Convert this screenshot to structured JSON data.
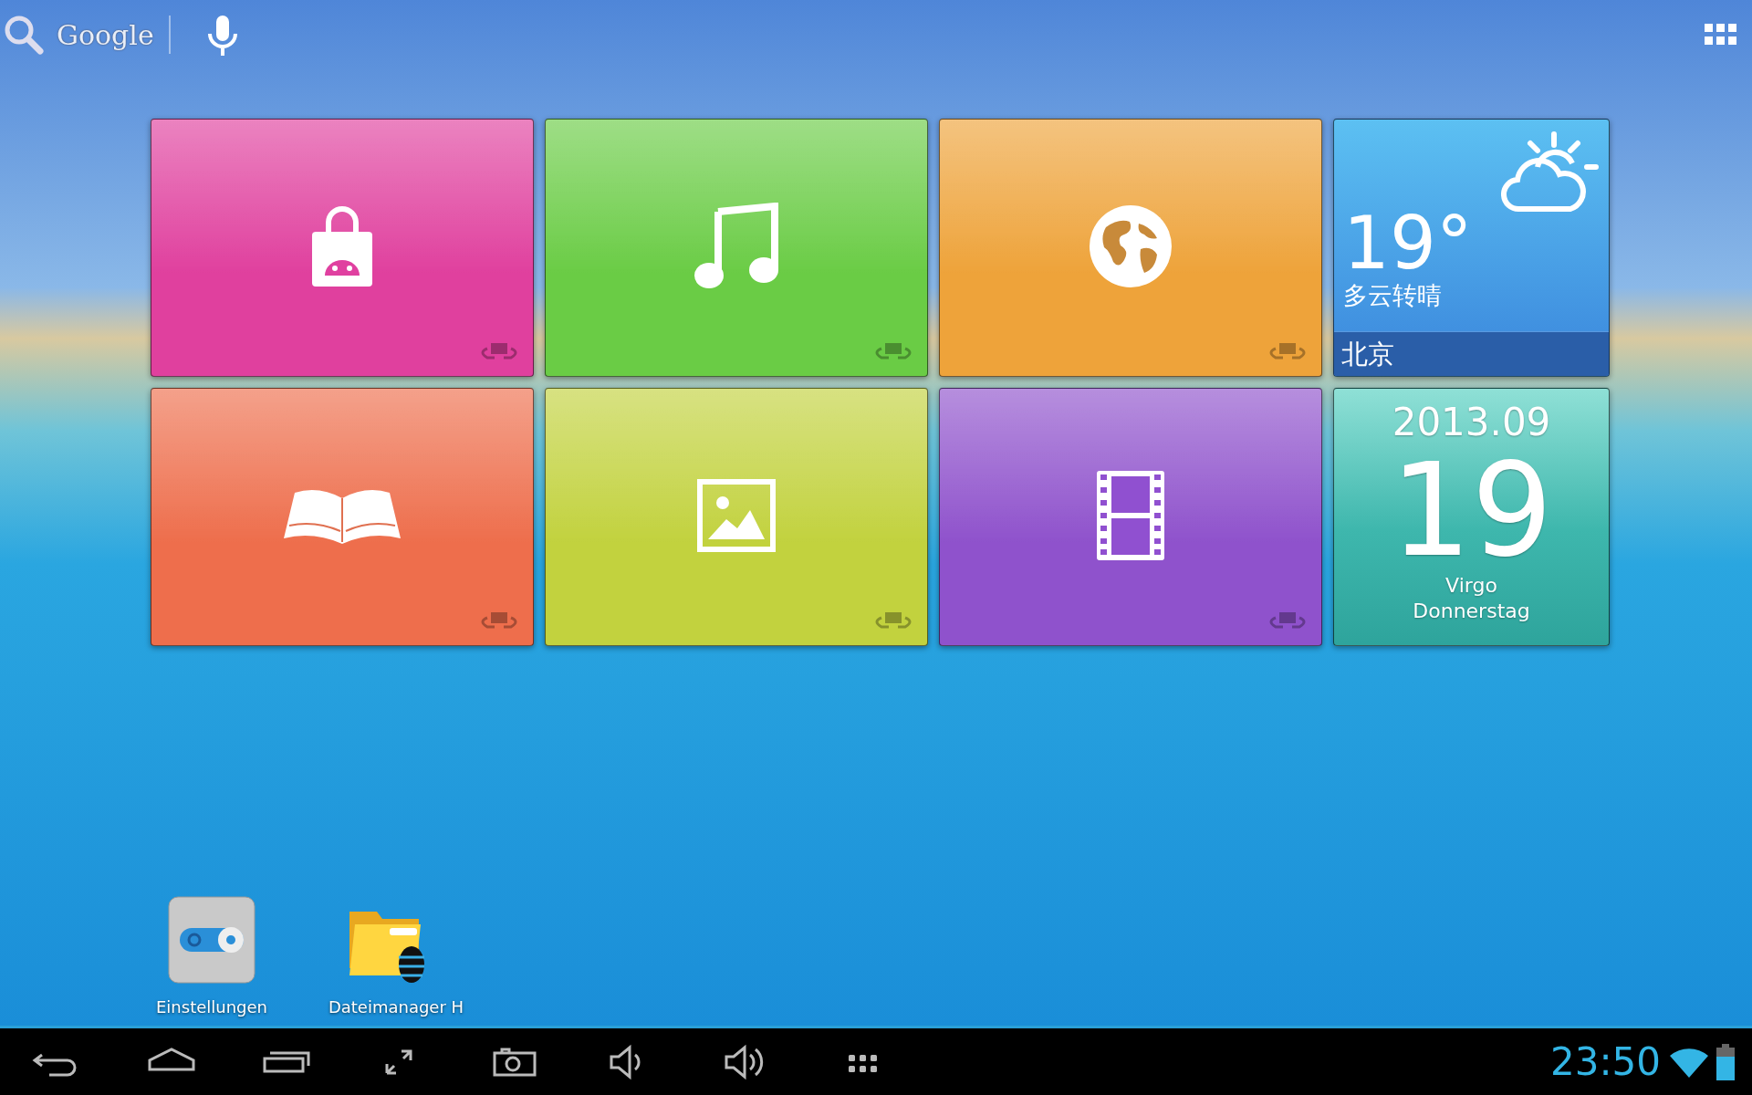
{
  "search_bar": {
    "logo": "Google"
  },
  "tiles": [
    {
      "color": "#e0409e"
    },
    {
      "color": "#6acc45"
    },
    {
      "color": "#eea33a"
    },
    {
      "color": "#ee6e4c"
    },
    {
      "color": "#c2d23e"
    },
    {
      "color": "#8f52cc"
    }
  ],
  "weather": {
    "temperature": "19°",
    "condition": "多云转晴",
    "city": "北京"
  },
  "calendar": {
    "month": "2013.09",
    "day": "19",
    "sign": "Virgo",
    "weekday": "Donnerstag"
  },
  "shortcuts": [
    {
      "label": "Einstellungen"
    },
    {
      "label": "Dateimanager H"
    }
  ],
  "nav_bar": {
    "clock": "23:50"
  }
}
